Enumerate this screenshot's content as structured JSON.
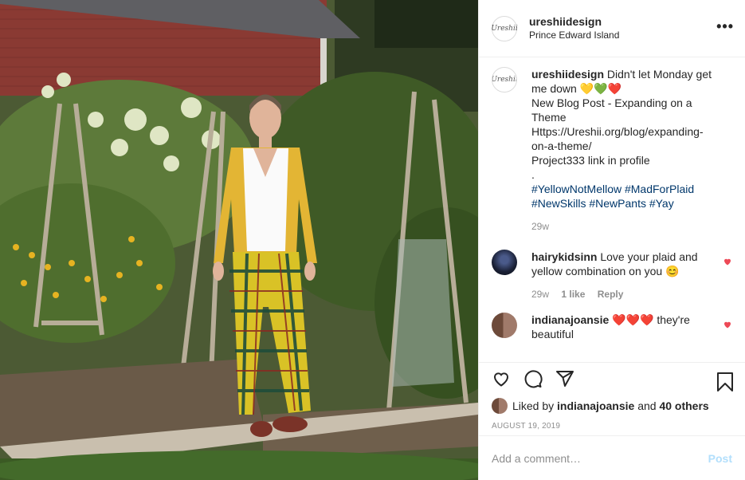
{
  "header": {
    "username": "ureshiidesign",
    "location": "Prince Edward Island",
    "avatar_text": "Ureshii",
    "more_icon": "more-horizontal-icon"
  },
  "caption": {
    "username": "ureshiidesign",
    "text_line1": "Didn't let Monday get me down 💛💚❤️",
    "text_line2": "New Blog Post - Expanding on a Theme",
    "text_line3": "Https://Ureshii.org/blog/expanding-on-a-theme/",
    "text_line4": "Project333 link in profile",
    "text_line5": ".",
    "hashtags": [
      "#YellowNotMellow",
      "#MadForPlaid",
      "#NewSkills",
      "#NewPants",
      "#Yay"
    ],
    "time": "29w"
  },
  "comments": [
    {
      "username": "hairykidsinn",
      "text": "Love your plaid and yellow combination on you 😊",
      "time": "29w",
      "likes": "1 like",
      "reply": "Reply"
    },
    {
      "username": "indianajoansie",
      "text": "❤️❤️❤️ they're beautiful"
    }
  ],
  "likes": {
    "prefix": "Liked by ",
    "user": "indianajoansie",
    "middle": " and ",
    "others": "40 others"
  },
  "date": "AUGUST 19, 2019",
  "add_comment": {
    "placeholder": "Add a comment…",
    "post_label": "Post"
  },
  "colors": {
    "link": "#00376b",
    "heart": "#ed4956",
    "muted": "#8e8e8e",
    "post_disabled": "#b2dffc"
  }
}
